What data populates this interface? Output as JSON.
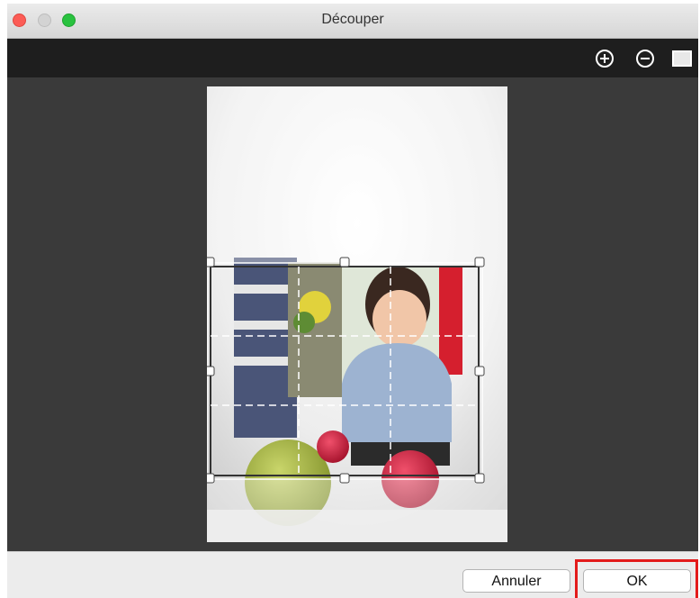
{
  "window": {
    "title": "Découper"
  },
  "toolbar": {
    "icons": [
      "zoom-in-icon",
      "zoom-out-icon",
      "fit-window-icon"
    ]
  },
  "buttons": {
    "cancel_label": "Annuler",
    "ok_label": "OK"
  },
  "colors": {
    "highlight": "#e31b1b",
    "toolbar_bg": "#1e1e1e",
    "canvas_bg": "#3a3a3a"
  }
}
